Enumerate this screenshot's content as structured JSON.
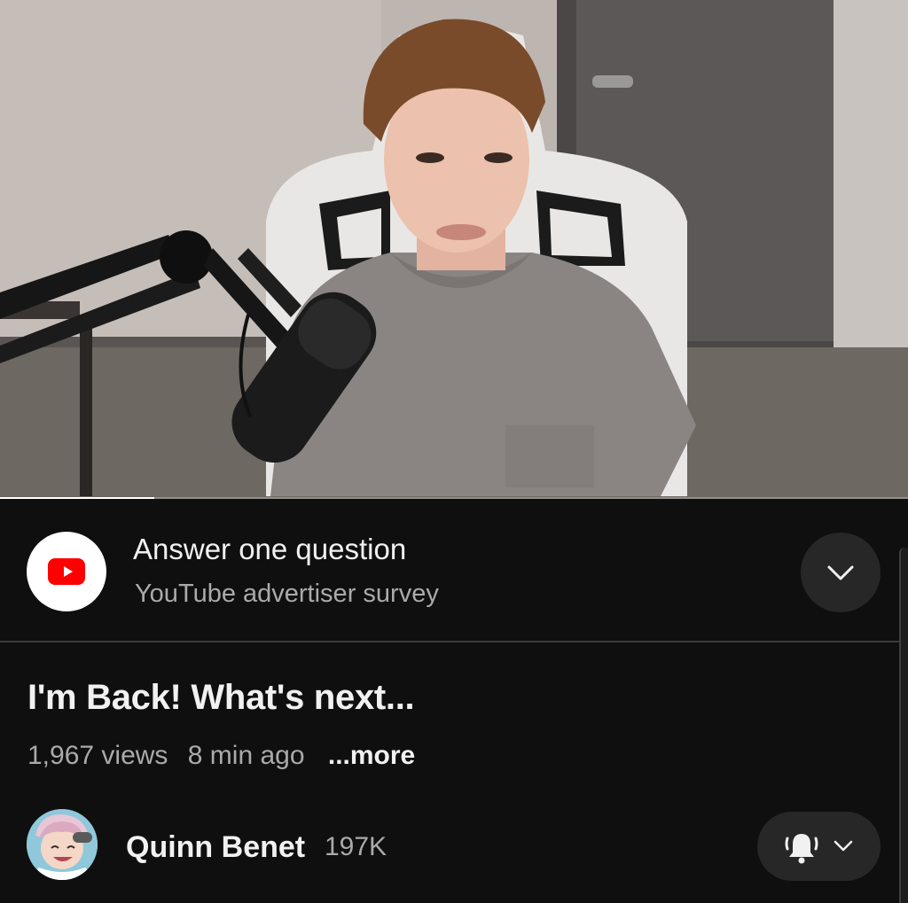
{
  "player": {
    "progress_fraction": 0.17
  },
  "survey": {
    "title": "Answer one question",
    "subtitle": "YouTube advertiser survey",
    "logo_icon": "youtube-logo-icon",
    "expand_icon": "chevron-down-icon"
  },
  "video": {
    "title": "I'm Back! What's next...",
    "views": "1,967 views",
    "age": "8 min ago",
    "more_label": "...more"
  },
  "channel": {
    "name": "Quinn Benet",
    "subscribers": "197K",
    "notify_icon": "bell-ringing-icon"
  },
  "colors": {
    "background": "#0f0f0f",
    "button_bg": "#272727",
    "secondary_text": "#aaaaaa",
    "youtube_red": "#ff0000"
  }
}
